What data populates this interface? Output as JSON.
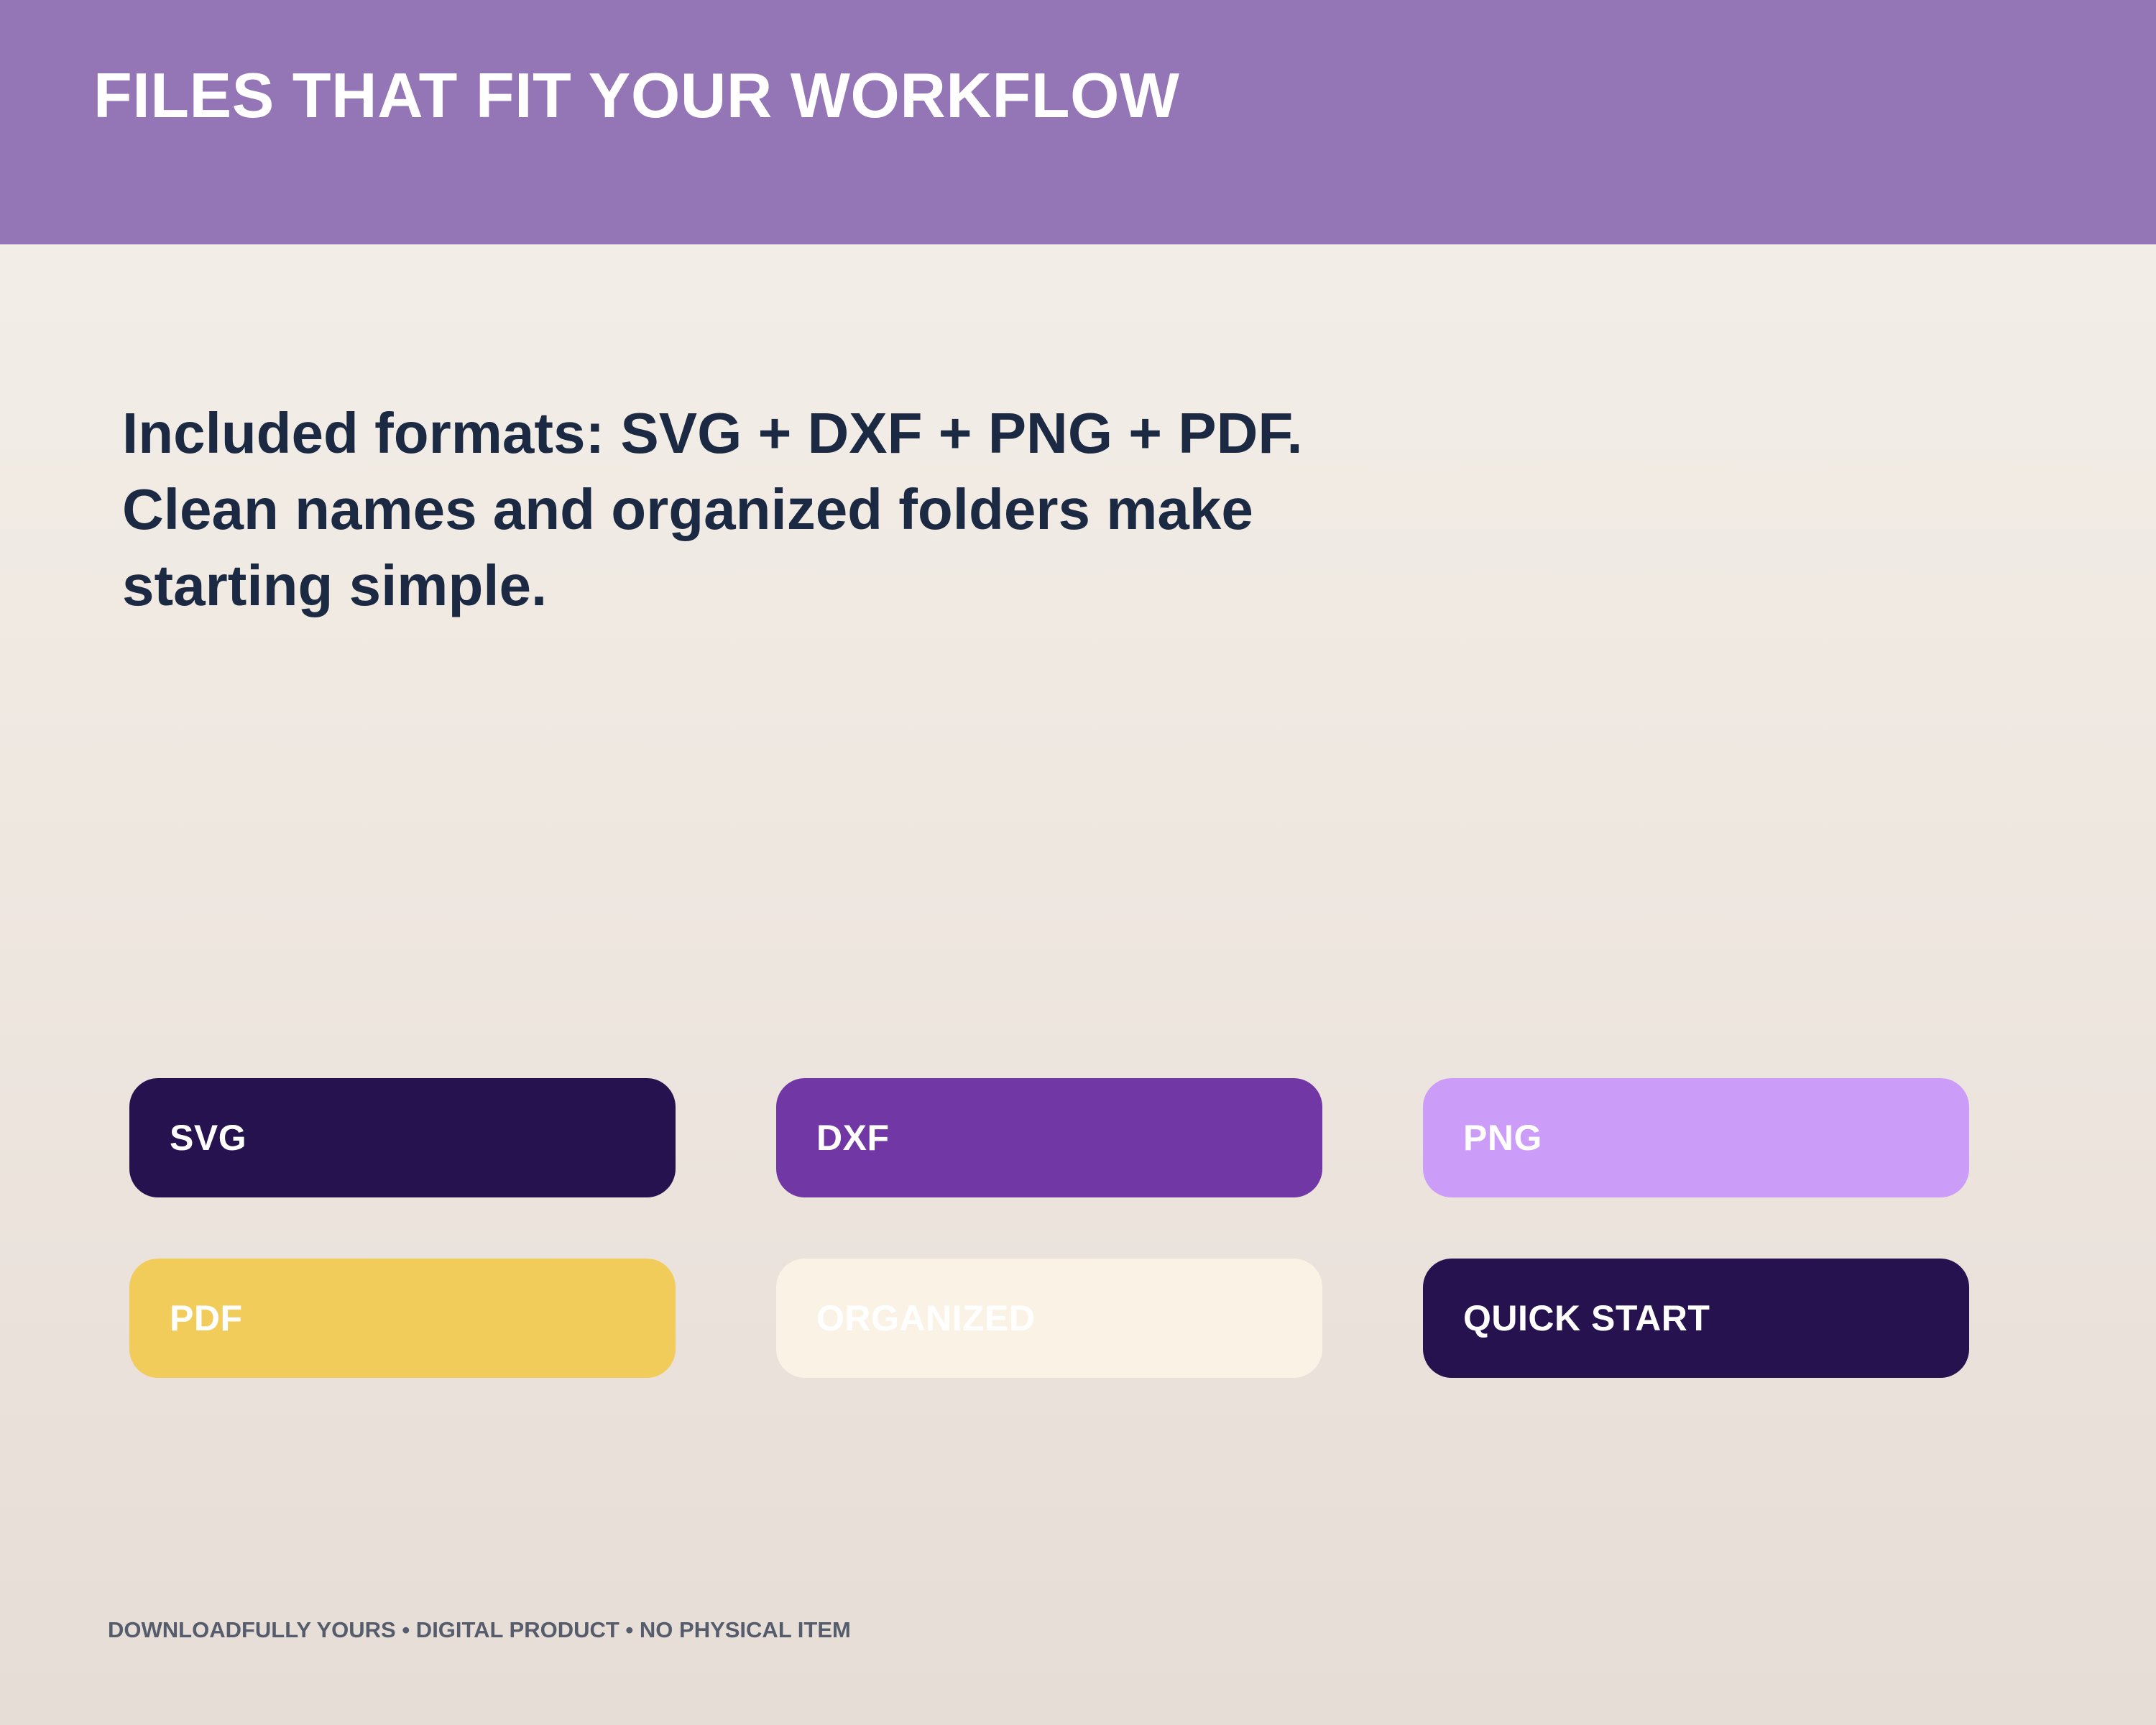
{
  "header": {
    "title": "FILES THAT FIT YOUR WORKFLOW"
  },
  "headline": {
    "lines": [
      "Included formats: SVG + DXF + PNG + PDF.",
      "Clean names and organized folders make",
      "starting simple."
    ]
  },
  "tags": [
    {
      "label": "SVG",
      "color": "#25124f"
    },
    {
      "label": "DXF",
      "color": "#7137a5"
    },
    {
      "label": "PNG",
      "color": "#cc9df8"
    },
    {
      "label": "PDF",
      "color": "#f1cc5b"
    },
    {
      "label": "ORGANIZED",
      "color": "#faf3e5"
    },
    {
      "label": "QUICK START",
      "color": "#25124f"
    }
  ],
  "footer": {
    "text": "DOWNLOADFULLY YOURS • DIGITAL PRODUCT • NO PHYSICAL ITEM"
  },
  "colors": {
    "header_bg": "#9475b5",
    "headline_text": "#1b2a42",
    "footer_text": "#555c6b"
  }
}
